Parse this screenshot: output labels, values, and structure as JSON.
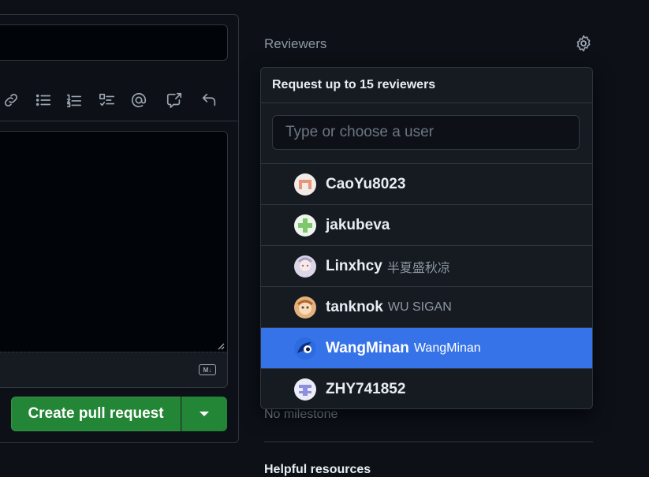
{
  "sidebar": {
    "reviewers_label": "Reviewers",
    "milestone_text": "No milestone",
    "helpful_resources": "Helpful resources"
  },
  "dropdown": {
    "header": "Request up to 15 reviewers",
    "filter_placeholder": "Type or choose a user",
    "users": [
      {
        "login": "CaoYu8023",
        "name": "",
        "avatar_color": "#e8957a"
      },
      {
        "login": "jakubeva",
        "name": "",
        "avatar_color": "#7ec86b"
      },
      {
        "login": "Linxhcy",
        "name": "半夏盛秋凉",
        "avatar_color": "#c9c2d6"
      },
      {
        "login": "tanknok",
        "name": "WU SIGAN",
        "avatar_color": "#d8a66a"
      },
      {
        "login": "WangMinan",
        "name": "WangMinan",
        "avatar_color": "#1f6feb",
        "selected": true
      },
      {
        "login": "ZHY741852",
        "name": "",
        "avatar_color": "#8f8fe0"
      }
    ]
  },
  "composer": {
    "create_button": "Create pull request",
    "markdown_badge": "M↓"
  },
  "colors": {
    "accent": "#3773e8",
    "button_green": "#238636",
    "background": "#0d1117"
  }
}
